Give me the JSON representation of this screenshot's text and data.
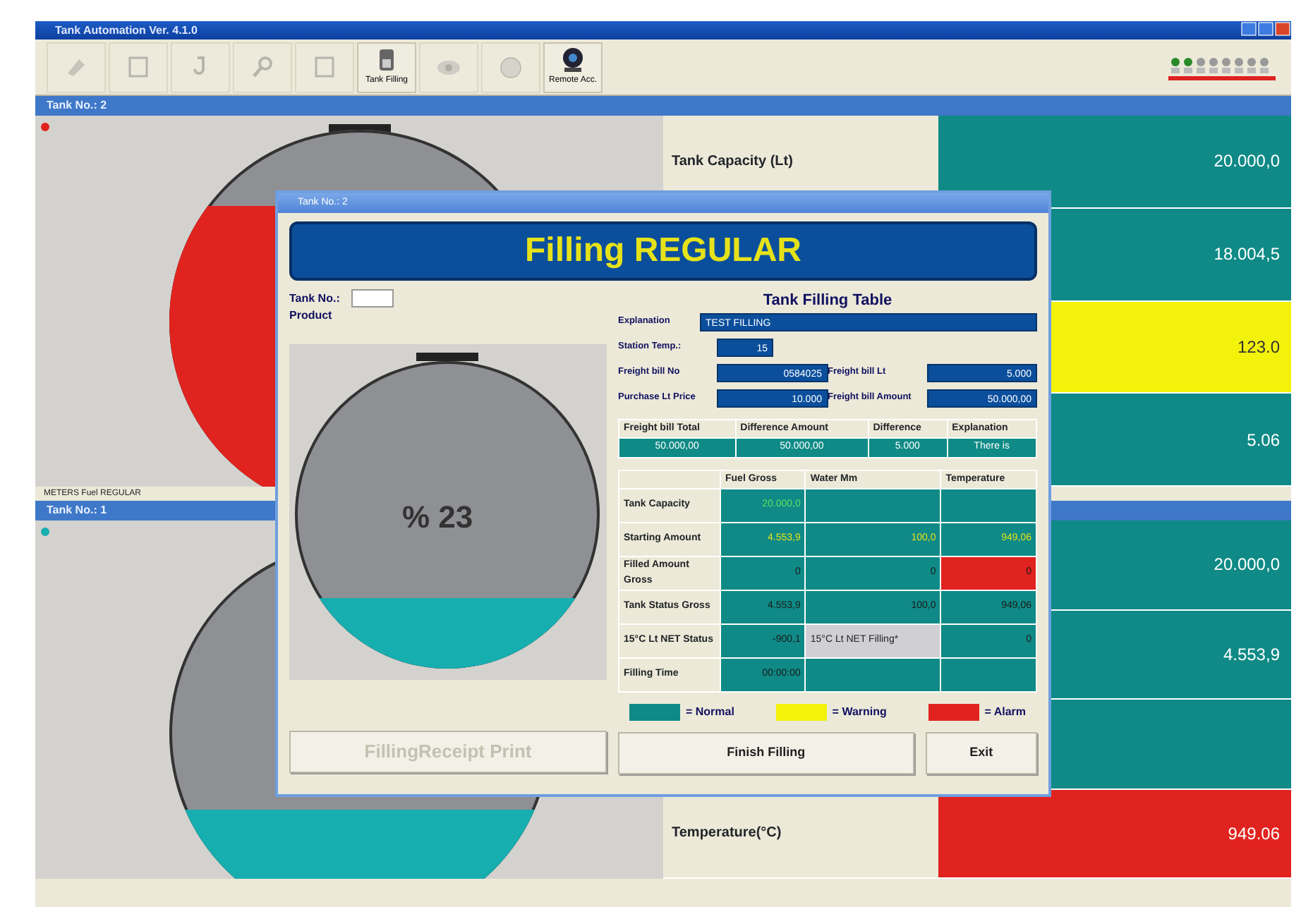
{
  "window": {
    "title": "Tank Automation Ver. 4.1.0"
  },
  "toolbar": [
    {
      "kind": "edit",
      "disabled": true
    },
    {
      "kind": "frame",
      "disabled": true
    },
    {
      "kind": "hook",
      "disabled": true
    },
    {
      "kind": "search",
      "disabled": true
    },
    {
      "kind": "frame",
      "disabled": true
    },
    {
      "kind": "tank",
      "disabled": false,
      "label": "Tank Filling"
    },
    {
      "kind": "eye",
      "disabled": true
    },
    {
      "kind": "globe",
      "disabled": true
    },
    {
      "kind": "remote",
      "disabled": false,
      "label": "Remote Acc."
    }
  ],
  "tank_windows": [
    {
      "title": "Tank No.: 2",
      "level": 0.8,
      "color": "#e0231f",
      "status_bar": "METERS   Fuel REGULAR",
      "info": [
        {
          "label": "Tank Capacity (Lt)",
          "value": "20.000,0",
          "color": "#0f8a86"
        },
        {
          "value": "18.004,5",
          "color": "#0f8a86"
        },
        {
          "value": "123.0",
          "color": "#f2f20a"
        },
        {
          "value": "5.06",
          "color": "#0f8a86"
        }
      ]
    },
    {
      "title": "Tank No.: 1",
      "level": 0.3,
      "color": "#17aeb0",
      "info": [
        {
          "value": "20.000,0",
          "color": "#0f8a86"
        },
        {
          "value": "4.553,9",
          "color": "#0f8a86"
        },
        {
          "color": "#0f8a86"
        },
        {
          "label": "Temperature(°C)",
          "value": "949.06",
          "color": "#e0231f"
        }
      ]
    }
  ],
  "dialog": {
    "title": "Tank No.: 2",
    "banner": "Filling REGULAR",
    "tank_no_label": "Tank No.:",
    "product_label": "Product",
    "tank": {
      "label": "% 23",
      "level": 0.23,
      "color": "#17aeb0"
    },
    "table_title": "Tank Filling Table",
    "fields": [
      {
        "label": "Explanation",
        "value": "TEST FILLING",
        "kind": "wide"
      },
      {
        "label": "Station Temp.:",
        "value": "15",
        "kind": "short"
      },
      {
        "label": "Freight bill No",
        "value": "0584025",
        "kind": "half"
      },
      {
        "label": "Freight bill Lt",
        "value": "5.000",
        "kind": "half"
      },
      {
        "label": "Purchase Lt Price",
        "value": "10.000",
        "kind": "half"
      },
      {
        "label": "Freight bill Amount",
        "value": "50.000,00",
        "kind": "half"
      }
    ],
    "summary": {
      "columns": [
        "Freight bill Total",
        "Difference Amount",
        "Difference",
        "Explanation"
      ],
      "row": [
        "50.000,00",
        "50.000,00",
        "5.000",
        "There is"
      ]
    },
    "table": {
      "columns": [
        "Fuel Gross",
        "Water Mm",
        "Temperature"
      ],
      "rows": [
        {
          "label": "Tank Capacity",
          "kind": "reference",
          "cells": [
            {
              "value": "20.000,0",
              "color": "#0f8a86"
            },
            {
              "color": "#0f8a86"
            },
            {
              "color": "#0f8a86"
            }
          ]
        },
        {
          "label": "Starting Amount",
          "kind": "start",
          "cells": [
            {
              "value": "4.553,9",
              "color": "#0f8a86"
            },
            {
              "value": "100,0",
              "color": "#0f8a86"
            },
            {
              "value": "949,06",
              "color": "#0f8a86"
            }
          ]
        },
        {
          "label": "Filled Amount Gross",
          "kind": "measure",
          "cells": [
            {
              "value": "0",
              "color": "#0f8a86"
            },
            {
              "value": "0",
              "color": "#0f8a86"
            },
            {
              "value": "0",
              "color": "#e0231f"
            }
          ]
        },
        {
          "label": "Tank Status Gross",
          "kind": "measure",
          "cells": [
            {
              "value": "4.553,9",
              "color": "#0f8a86"
            },
            {
              "value": "100,0",
              "color": "#0f8a86"
            },
            {
              "value": "949,06",
              "color": "#0f8a86"
            }
          ]
        },
        {
          "label": "15°C Lt NET Status",
          "kind": "measure",
          "cells": [
            {
              "value": "-900,1",
              "color": "#0f8a86"
            },
            {
              "value": "15°C Lt NET Filling*",
              "color": "#cfcfd4"
            },
            {
              "value": "0",
              "color": "#0f8a86"
            }
          ]
        },
        {
          "label": "Filling Time",
          "kind": "measure",
          "cells": [
            {
              "value": "00:00:00",
              "color": "#0f8a86"
            },
            {
              "color": "#0f8a86"
            },
            {
              "color": "#0f8a86"
            }
          ]
        }
      ]
    },
    "legend": [
      {
        "label": "= Normal",
        "color": "#0f8a86"
      },
      {
        "label": "= Warning",
        "color": "#f2f20a"
      },
      {
        "label": "= Alarm",
        "color": "#e0231f"
      }
    ],
    "buttons": [
      {
        "label": "FillingReceipt Print",
        "disabled": true
      },
      {
        "label": "Finish Filling",
        "disabled": false
      },
      {
        "label": "Exit",
        "disabled": false
      }
    ]
  }
}
